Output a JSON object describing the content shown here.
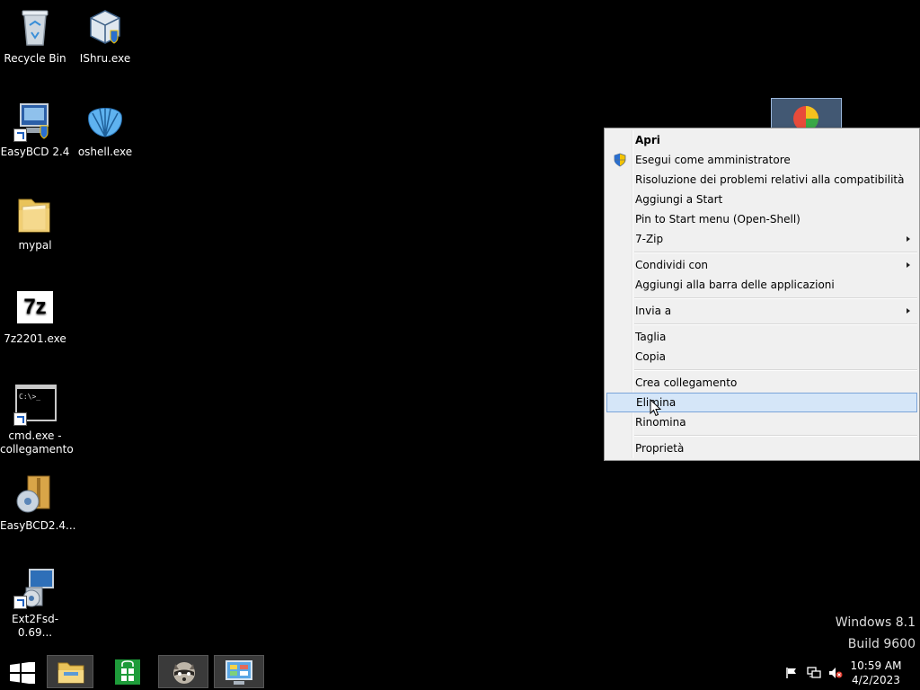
{
  "desktop": {
    "icons": [
      {
        "label": "Recycle Bin",
        "icon": "recycle-bin-icon"
      },
      {
        "label": "IShru.exe",
        "icon": "virtualbox-icon"
      },
      {
        "label": "EasyBCD 2.4",
        "icon": "easybcd-icon"
      },
      {
        "label": "oshell.exe",
        "icon": "shell-icon"
      },
      {
        "label": "mypal",
        "icon": "folder-icon"
      },
      {
        "label": "7z2201.exe",
        "icon": "7zip-icon"
      },
      {
        "label": "cmd.exe -\ncollegamento",
        "icon": "cmd-icon"
      },
      {
        "label": "EasyBCD2.4...",
        "icon": "installer-icon"
      },
      {
        "label": "Ext2Fsd-0.69...",
        "icon": "setup-icon"
      }
    ],
    "zip_glyph": "7z",
    "cmd_glyph": "C:\\>_"
  },
  "context_menu": {
    "items": [
      {
        "label": "Apri"
      },
      {
        "label": "Esegui come amministratore"
      },
      {
        "label": "Risoluzione dei problemi relativi alla compatibilità"
      },
      {
        "label": "Aggiungi a Start"
      },
      {
        "label": "Pin to Start menu (Open-Shell)"
      },
      {
        "label": "7-Zip"
      },
      {
        "label": "Condividi con"
      },
      {
        "label": "Aggiungi alla barra delle applicazioni"
      },
      {
        "label": "Invia a"
      },
      {
        "label": "Taglia"
      },
      {
        "label": "Copia"
      },
      {
        "label": "Crea collegamento"
      },
      {
        "label": "Elimina"
      },
      {
        "label": "Rinomina"
      },
      {
        "label": "Proprietà"
      }
    ],
    "highlighted": "Elimina"
  },
  "watermark": {
    "line1": "Windows 8.1",
    "line2": "Build 9600"
  },
  "taskbar": {
    "clock_time": "10:59 AM",
    "clock_date": "4/2/2023",
    "buttons": [
      "start-icon",
      "file-explorer-icon",
      "store-icon",
      "raccoon-app-icon",
      "control-panel-icon"
    ]
  },
  "colors": {
    "menu_bg": "#f0f0f0",
    "highlight": "#d5e6f8",
    "highlight_border": "#7ba4d9",
    "desktop_bg": "#000000"
  }
}
